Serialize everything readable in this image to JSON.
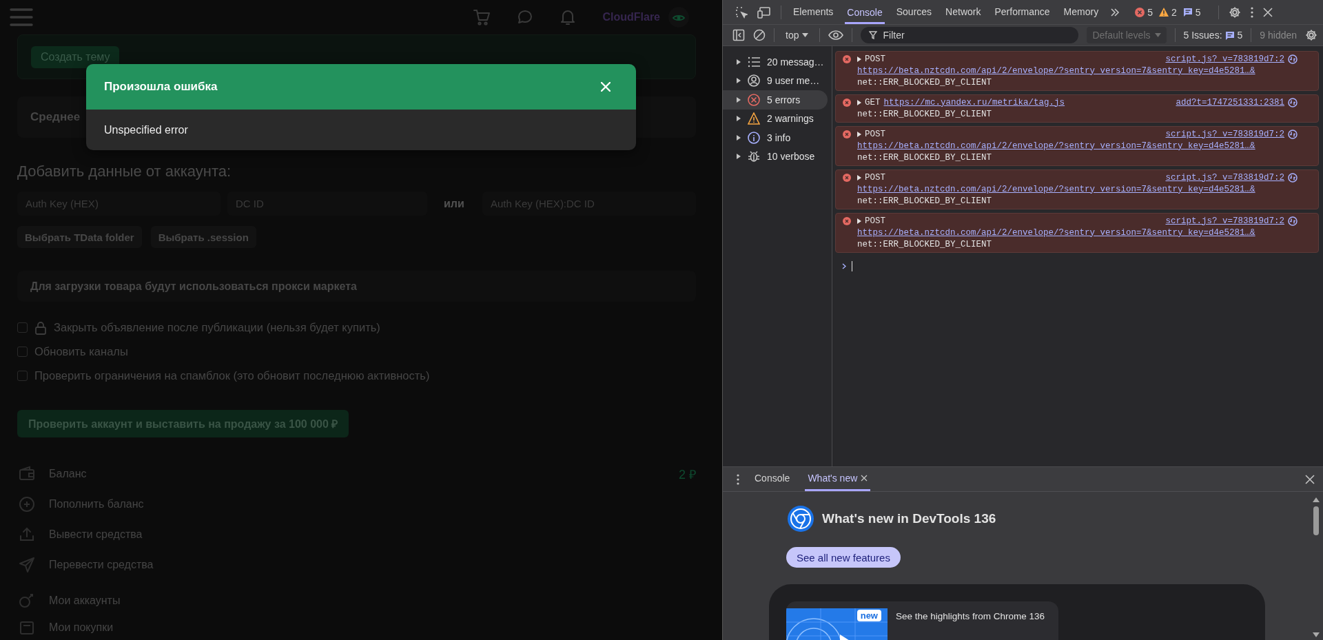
{
  "page": {
    "header": {
      "user_name": "CloudFlare"
    },
    "create_topic_button": "Создать тему",
    "stats_heading": "Среднее",
    "add_account": {
      "title": "Добавить данные от аккаунта:",
      "fields": [
        {
          "placeholder": "Auth Key (HEX)"
        },
        {
          "placeholder": "DC ID"
        }
      ],
      "or_label": "или",
      "alt_field": {
        "placeholder": "Auth Key (HEX):DC ID"
      },
      "buttons": [
        "Выбрать TData folder",
        "Выбрать .session"
      ]
    },
    "proxy_notice": "Для загрузки товара будут использоваться прокси маркета",
    "options": [
      {
        "label": "Закрыть объявление после публикации (нельзя будет купить)",
        "checked": false,
        "locked": true
      },
      {
        "label": "Обновить каналы",
        "checked": false,
        "locked": false
      },
      {
        "label": "Проверить ограничения на спамблок (это обновит последнюю активность)",
        "checked": false,
        "locked": false
      }
    ],
    "submit_button": "Проверить аккаунт и выставить на продажу за 100 000 ₽",
    "menu": [
      {
        "label": "Баланс",
        "value": "2 ₽"
      },
      {
        "label": "Пополнить баланс"
      },
      {
        "label": "Вывести средства"
      },
      {
        "label": "Перевести средства"
      }
    ],
    "menu_2": [
      {
        "label": "Мои аккаунты"
      },
      {
        "label": "Мои покупки"
      }
    ]
  },
  "dialog": {
    "title": "Произошла ошибка",
    "message": "Unspecified error"
  },
  "devtools": {
    "tabs": [
      {
        "label": "Elements",
        "selected": false
      },
      {
        "label": "Console",
        "selected": true
      },
      {
        "label": "Sources",
        "selected": false
      },
      {
        "label": "Network",
        "selected": false
      },
      {
        "label": "Performance",
        "selected": false
      },
      {
        "label": "Memory",
        "selected": false
      }
    ],
    "counts": {
      "errors": "5",
      "warnings": "2",
      "issues": "5"
    },
    "console_toolbar": {
      "context": "top",
      "filter": {
        "placeholder": "Filter"
      },
      "levels": "Default levels",
      "issues_label": "5 Issues:",
      "issues_count": "5",
      "hidden": "9 hidden"
    },
    "sidebar": [
      {
        "label": "20 messag…",
        "selected": false
      },
      {
        "label": "9 user me…",
        "selected": false
      },
      {
        "label": "5 errors",
        "selected": true
      },
      {
        "label": "2 warnings",
        "selected": false
      },
      {
        "label": "3 info",
        "selected": false
      },
      {
        "label": "10 verbose",
        "selected": false
      }
    ],
    "messages": [
      {
        "kind": "wrapped",
        "method": "POST",
        "url": "https://beta.nztcdn.com/api/2/envelope/?sentry_version=7&sentry_key=d4e5281…&",
        "source": "script.js?_v=783819d7:2",
        "error": "net::ERR_BLOCKED_BY_CLIENT"
      },
      {
        "kind": "inline",
        "method": "GET",
        "url": "https://mc.yandex.ru/metrika/tag.js",
        "source": "add?t=1747251331:2381",
        "error": "net::ERR_BLOCKED_BY_CLIENT"
      },
      {
        "kind": "wrapped",
        "method": "POST",
        "url": "https://beta.nztcdn.com/api/2/envelope/?sentry_version=7&sentry_key=d4e5281…&",
        "source": "script.js?_v=783819d7:2",
        "error": "net::ERR_BLOCKED_BY_CLIENT"
      },
      {
        "kind": "wrapped",
        "method": "POST",
        "url": "https://beta.nztcdn.com/api/2/envelope/?sentry_version=7&sentry_key=d4e5281…&",
        "source": "script.js?_v=783819d7:2",
        "error": "net::ERR_BLOCKED_BY_CLIENT"
      },
      {
        "kind": "wrapped",
        "method": "POST",
        "url": "https://beta.nztcdn.com/api/2/envelope/?sentry_version=7&sentry_key=d4e5281…&",
        "source": "script.js?_v=783819d7:2",
        "error": "net::ERR_BLOCKED_BY_CLIENT"
      }
    ],
    "drawer": {
      "tabs": [
        {
          "label": "Console",
          "selected": false,
          "closable": false
        },
        {
          "label": "What's new",
          "selected": true,
          "closable": true
        }
      ],
      "title": "What's new in DevTools 136",
      "button": "See all new features",
      "highlight": {
        "badge": "new",
        "text": "See the highlights from Chrome 136"
      }
    }
  }
}
